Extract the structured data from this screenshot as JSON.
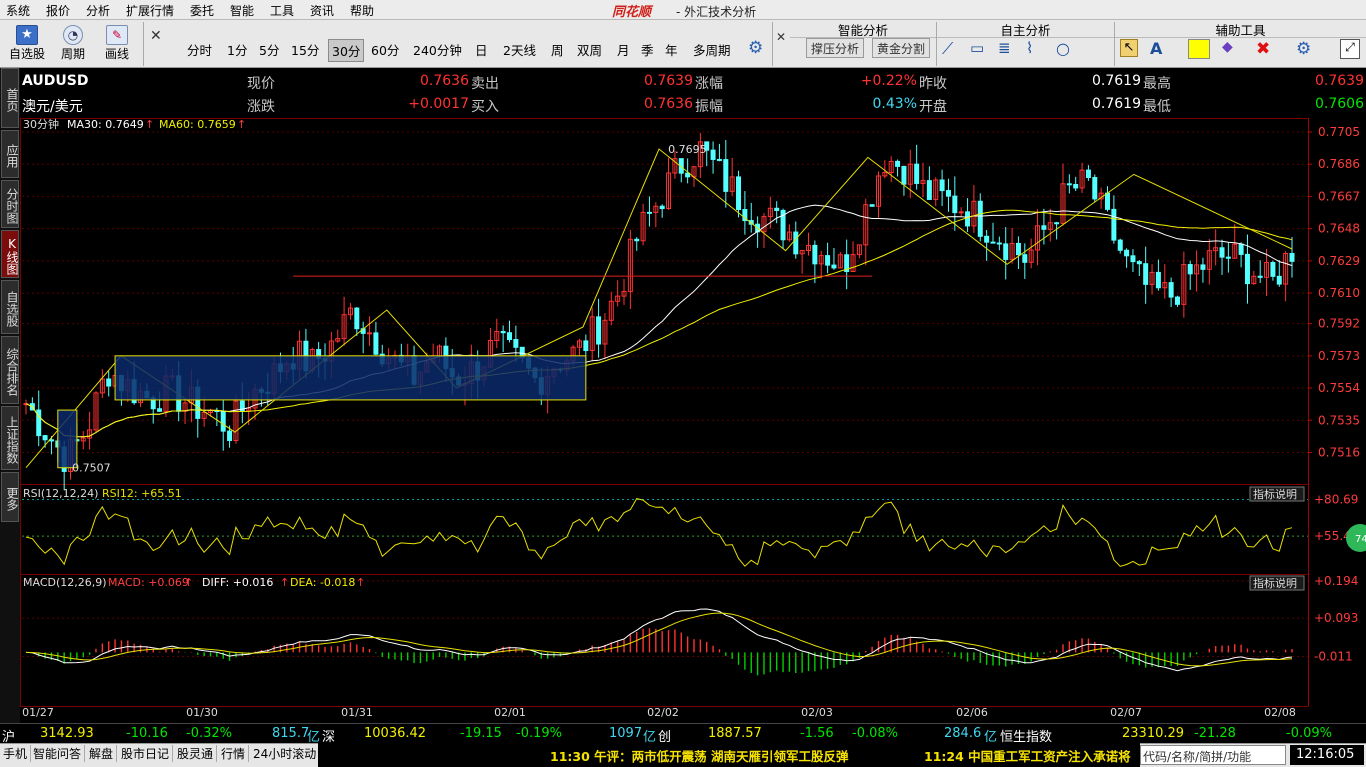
{
  "menu": [
    "系统",
    "报价",
    "分析",
    "扩展行情",
    "委托",
    "智能",
    "工具",
    "资讯",
    "帮助"
  ],
  "brand": "同花顺",
  "app_title": "- 外汇技术分析",
  "toolbar": {
    "left_buttons": [
      "自选股",
      "周期",
      "画线"
    ],
    "periods": [
      "分时",
      "1分",
      "5分",
      "15分",
      "30分",
      "60分",
      "240分钟",
      "日",
      "2天线",
      "周",
      "双周",
      "月",
      "季",
      "年",
      "多周期"
    ],
    "selected_period": "30分",
    "group_smart": "智能分析",
    "smart_buttons": [
      "撑压分析",
      "黄金分割"
    ],
    "group_self": "自主分析",
    "group_aux": "辅助工具"
  },
  "left_tabs": [
    "首页",
    "应用",
    "分时图",
    "K线图",
    "自选股",
    "综合排名",
    "上证指数",
    "更多"
  ],
  "active_tab": "K线图",
  "quote": {
    "symbol": "AUDUSD",
    "name": "澳元/美元",
    "rows": [
      [
        {
          "l": "现价",
          "v": "0.7636",
          "c": "red"
        },
        {
          "l": "卖出",
          "v": "0.7639",
          "c": "red"
        },
        {
          "l": "涨幅",
          "v": "+0.22%",
          "c": "red"
        },
        {
          "l": "昨收",
          "v": "0.7619",
          "c": "wht"
        },
        {
          "l": "最高",
          "v": "0.7639",
          "c": "red"
        }
      ],
      [
        {
          "l": "涨跌",
          "v": "+0.0017",
          "c": "red"
        },
        {
          "l": "买入",
          "v": "0.7636",
          "c": "red"
        },
        {
          "l": "振幅",
          "v": "0.43%",
          "c": "cyn"
        },
        {
          "l": "开盘",
          "v": "0.7619",
          "c": "wht"
        },
        {
          "l": "最低",
          "v": "0.7606",
          "c": "grn"
        }
      ]
    ]
  },
  "chart_data": [
    {
      "type": "candlestick",
      "period_label": "30分钟",
      "indicators": [
        {
          "name": "MA30",
          "value": "0.7649",
          "color": "#ffffff"
        },
        {
          "name": "MA60",
          "value": "0.7659",
          "color": "#f0f000"
        }
      ],
      "y_ticks": [
        "0.7705",
        "0.7686",
        "0.7667",
        "0.7648",
        "0.7629",
        "0.7610",
        "0.7592",
        "0.7573",
        "0.7554",
        "0.7535",
        "0.7516"
      ],
      "ylim": [
        0.7498,
        0.7705
      ],
      "x_ticks": [
        "01/27",
        "01/30",
        "01/31",
        "02/01",
        "02/02",
        "02/03",
        "02/06",
        "02/07",
        "02/08"
      ],
      "annotations": [
        {
          "text": "0.7695",
          "price": 0.7695
        },
        {
          "text": "0.7507",
          "price": 0.7507
        }
      ],
      "candles_approx": 200,
      "close_path": [
        0.7545,
        0.7528,
        0.7512,
        0.753,
        0.7565,
        0.7555,
        0.7548,
        0.7552,
        0.7545,
        0.754,
        0.753,
        0.755,
        0.756,
        0.7575,
        0.7568,
        0.758,
        0.76,
        0.7585,
        0.757,
        0.756,
        0.7575,
        0.756,
        0.7565,
        0.758,
        0.757,
        0.7558,
        0.757,
        0.7575,
        0.759,
        0.761,
        0.7645,
        0.7665,
        0.7685,
        0.7695,
        0.768,
        0.7665,
        0.7655,
        0.765,
        0.764,
        0.7635,
        0.7625,
        0.7655,
        0.769,
        0.7685,
        0.767,
        0.7665,
        0.766,
        0.765,
        0.764,
        0.763,
        0.765,
        0.767,
        0.7675,
        0.765,
        0.7625,
        0.7612,
        0.7608,
        0.762,
        0.763,
        0.7632,
        0.7624,
        0.7615,
        0.7636
      ]
    },
    {
      "type": "line",
      "label": "RSI(12,12,24)",
      "value_label": "RSI12: +65.51",
      "y_ticks": [
        "+80.69",
        "+55.40"
      ],
      "ylim": [
        30,
        90
      ]
    },
    {
      "type": "bar",
      "label": "MACD(12,26,9)",
      "values": [
        {
          "name": "MACD",
          "value": "+0.069",
          "color": "#ff4040"
        },
        {
          "name": "DIFF",
          "value": "+0.016",
          "color": "#ffffff"
        },
        {
          "name": "DEA",
          "value": "-0.018",
          "color": "#f0f000"
        }
      ],
      "y_ticks": [
        "+0.194",
        "+0.093",
        "-0.011"
      ],
      "ylim": [
        -0.14,
        0.21
      ]
    }
  ],
  "indicator_button": "指标说明",
  "badge_value": "74",
  "status": {
    "sh": {
      "label": "沪",
      "price": "3142.93",
      "chg": "-10.16",
      "pct": "-0.32%",
      "amt": "815.7",
      "unit": "亿"
    },
    "sz": {
      "label": "深",
      "price": "10036.42",
      "chg": "-19.15",
      "pct": "-0.19%",
      "amt": "1097",
      "unit": "亿"
    },
    "cy": {
      "label": "创",
      "price": "1887.57",
      "chg": "-1.56",
      "pct": "-0.08%",
      "amt": "284.6",
      "unit": "亿"
    },
    "hs": {
      "label": "恒生指数",
      "price": "23310.29",
      "chg": "-21.28",
      "pct": "-0.09%"
    }
  },
  "bottom": {
    "buttons": [
      "手机",
      "智能问答",
      "解盘",
      "股市日记",
      "股灵通",
      "行情",
      "24小时滚动"
    ],
    "news": [
      "11:30 午评：两市低开震荡 湖南天雁引领军工股反弹",
      "11:24 中国重工军工资产注入承诺将"
    ],
    "search_placeholder": "代码/名称/简拼/功能",
    "clock": "12:16:05"
  },
  "colors": {
    "up": "#ff3232",
    "down": "#54ffff",
    "ma30": "#ffffff",
    "ma60": "#f0f000",
    "grid": "#5a0000"
  }
}
